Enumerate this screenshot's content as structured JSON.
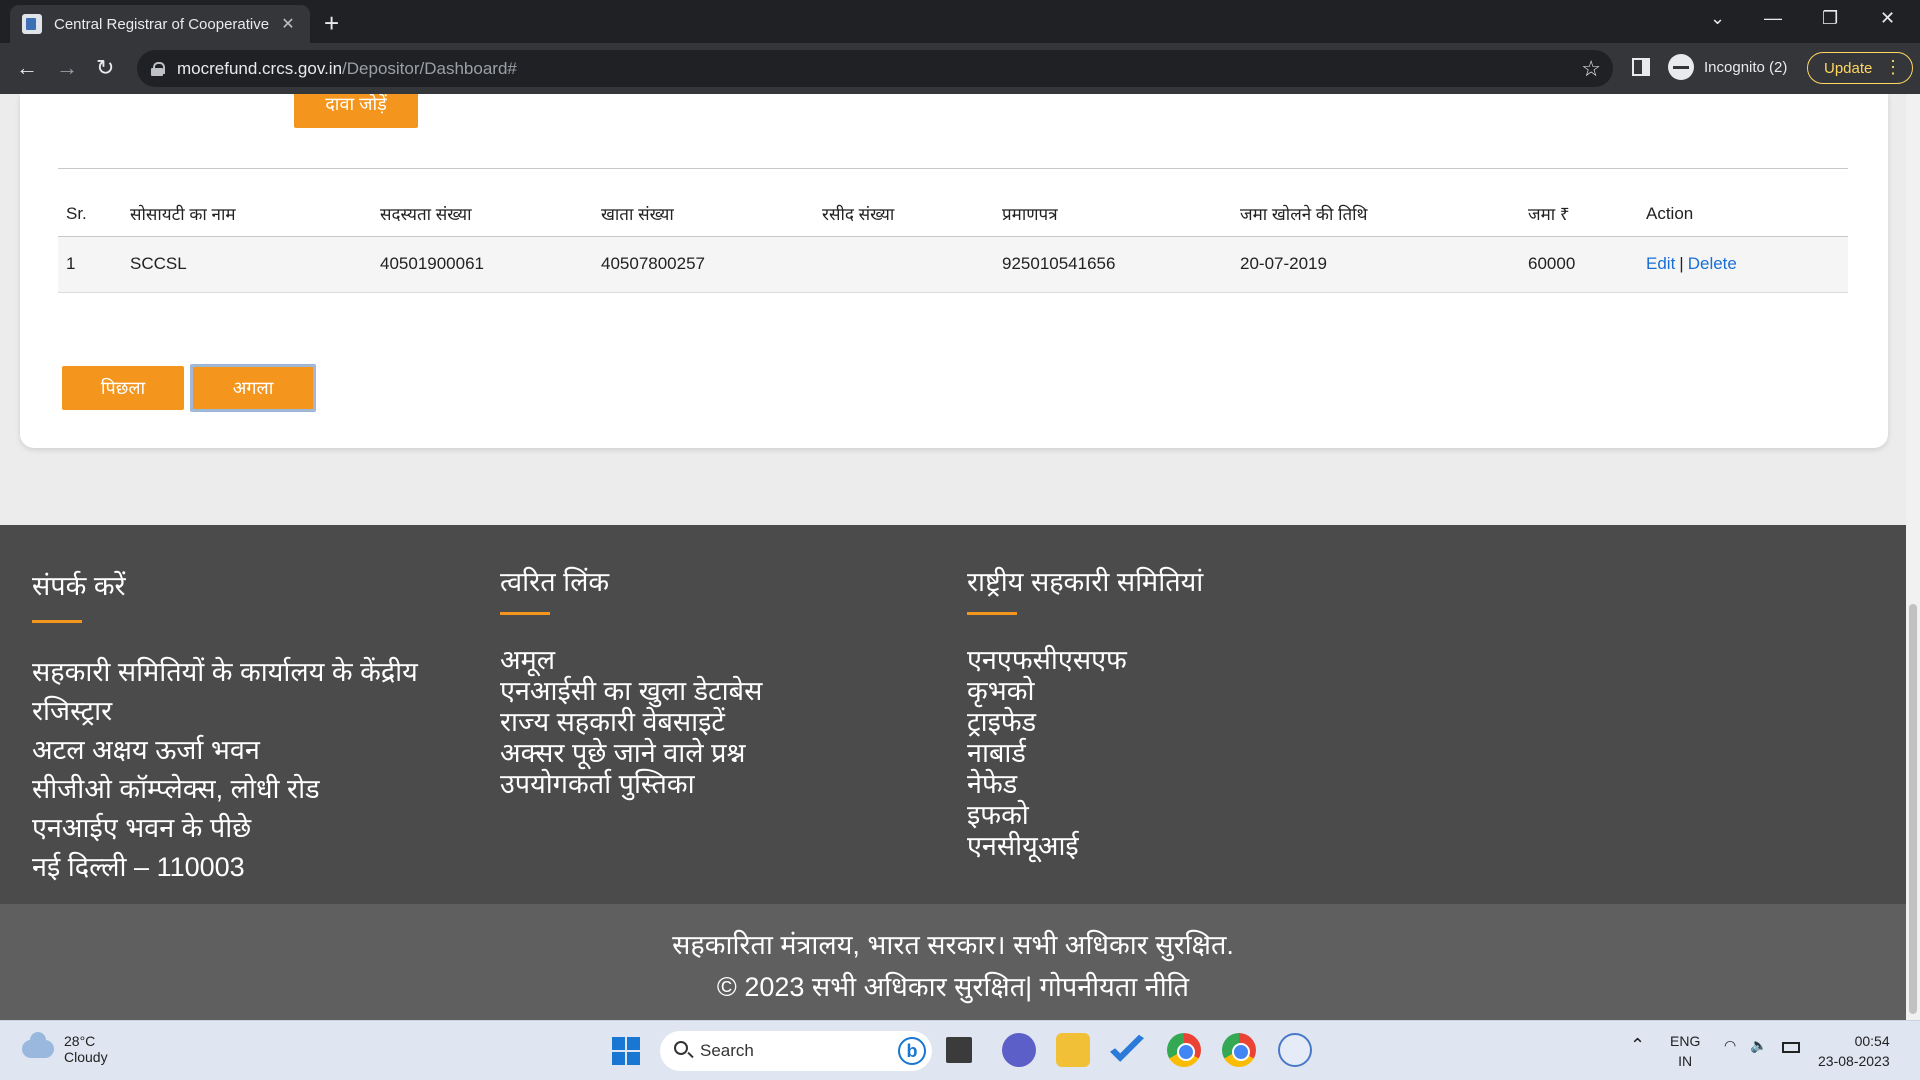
{
  "browser": {
    "tab_title": "Central Registrar of Cooperative",
    "tab_close": "✕",
    "new_tab": "+",
    "url_host": "mocrefund.crcs.gov.in",
    "url_path": "/Depositor/Dashboard#",
    "incognito_label": "Incognito (2)",
    "update_label": "Update",
    "window_controls": [
      "⌄",
      "—",
      "❐",
      "✕"
    ],
    "nav": {
      "back": "←",
      "forward": "→",
      "reload": "↻"
    }
  },
  "page": {
    "add_claim_label": "दावा जोड़ें",
    "table": {
      "headers": [
        "Sr.",
        "सोसायटी का नाम",
        "सदस्यता संख्या",
        "खाता संख्या",
        "रसीद संख्या",
        "प्रमाणपत्र",
        "जमा खोलने की तिथि",
        "जमा ₹",
        "Action"
      ],
      "rows": [
        {
          "sr": "1",
          "society": "SCCSL",
          "membership": "40501900061",
          "account": "40507800257",
          "receipt": "",
          "certificate": "925010541656",
          "date": "20-07-2019",
          "amount": "60000",
          "edit": "Edit",
          "sep": "|",
          "delete": "Delete"
        }
      ]
    },
    "prev_label": "पिछला",
    "next_label": "अगला"
  },
  "footer": {
    "contact": {
      "heading": "संपर्क करें",
      "lines": [
        "सहकारी समितियों के कार्यालय के केंद्रीय",
        "रजिस्ट्रार",
        "अटल अक्षय ऊर्जा भवन",
        "सीजीओ कॉम्प्लेक्स, लोधी रोड",
        "एनआईए भवन के पीछे",
        "नई दिल्ली – 110003"
      ]
    },
    "quick_links": {
      "heading": "त्वरित लिंक",
      "items": [
        "अमूल",
        "एनआईसी का खुला डेटाबेस",
        "राज्य सहकारी वेबसाइटें",
        "अक्सर पूछे जाने वाले प्रश्न",
        "उपयोगकर्ता पुस्तिका"
      ]
    },
    "national": {
      "heading": "राष्ट्रीय सहकारी समितियां",
      "items": [
        "एनएफसीएसएफ",
        "कृभको",
        "ट्राइफेड",
        "नाबार्ड",
        "नेफेड",
        "इफको",
        "एनसीयूआई"
      ]
    },
    "copyright_line1": "सहकारिता मंत्रालय, भारत सरकार। सभी अधिकार सुरक्षित.",
    "copyright_line2": "© 2023 सभी अधिकार सुरक्षित| गोपनीयता नीति"
  },
  "taskbar": {
    "temp": "28°C",
    "weather": "Cloudy",
    "search_label": "Search",
    "lang1": "ENG",
    "lang2": "IN",
    "time": "00:54",
    "date": "23-08-2023"
  }
}
